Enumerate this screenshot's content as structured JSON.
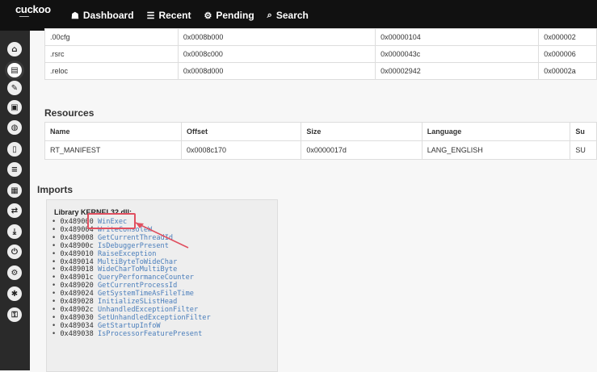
{
  "brand": {
    "logo": "cuckoo"
  },
  "nav": [
    {
      "icon": "dashboard-icon",
      "glyph": "☗",
      "label": "Dashboard"
    },
    {
      "icon": "list-icon",
      "glyph": "☰",
      "label": "Recent"
    },
    {
      "icon": "cogs-icon",
      "glyph": "⚙",
      "label": "Pending"
    },
    {
      "icon": "search-icon",
      "glyph": "⌕",
      "label": "Search"
    }
  ],
  "sidebar": [
    {
      "name": "home-icon",
      "glyph": "⌂"
    },
    {
      "name": "file-icon",
      "glyph": "▤"
    },
    {
      "name": "pencil-icon",
      "glyph": "✎"
    },
    {
      "name": "box-icon",
      "glyph": "▣"
    },
    {
      "name": "globe-icon",
      "glyph": "◍"
    },
    {
      "name": "document-icon",
      "glyph": "▯"
    },
    {
      "name": "database-icon",
      "glyph": "≡"
    },
    {
      "name": "qrcode-icon",
      "glyph": "▦"
    },
    {
      "name": "shuffle-icon",
      "glyph": "⇄"
    },
    {
      "name": "download-icon",
      "glyph": "⤓"
    },
    {
      "name": "power-icon",
      "glyph": "⏻"
    },
    {
      "name": "settings-icon",
      "glyph": "⚙"
    },
    {
      "name": "bug-icon",
      "glyph": "✱"
    },
    {
      "name": "unlock-icon",
      "glyph": "⚿"
    }
  ],
  "sections": {
    "rows": [
      [
        ".00cfg",
        "0x0008b000",
        "0x00000104",
        "0x000002"
      ],
      [
        ".rsrc",
        "0x0008c000",
        "0x0000043c",
        "0x000006"
      ],
      [
        ".reloc",
        "0x0008d000",
        "0x00002942",
        "0x00002a"
      ]
    ]
  },
  "resources": {
    "title": "Resources",
    "headers": [
      "Name",
      "Offset",
      "Size",
      "Language",
      "Su"
    ],
    "rows": [
      [
        "RT_MANIFEST",
        "0x0008c170",
        "0x0000017d",
        "LANG_ENGLISH",
        "SU"
      ]
    ]
  },
  "imports": {
    "title": "Imports",
    "library": "Library KERNEL32.dll:",
    "entries": [
      {
        "addr": "0x489000",
        "fn": "WinExec"
      },
      {
        "addr": "0x489004",
        "fn": "WriteConsoleW"
      },
      {
        "addr": "0x489008",
        "fn": "GetCurrentThreadId"
      },
      {
        "addr": "0x48900c",
        "fn": "IsDebuggerPresent"
      },
      {
        "addr": "0x489010",
        "fn": "RaiseException"
      },
      {
        "addr": "0x489014",
        "fn": "MultiByteToWideChar"
      },
      {
        "addr": "0x489018",
        "fn": "WideCharToMultiByte"
      },
      {
        "addr": "0x48901c",
        "fn": "QueryPerformanceCounter"
      },
      {
        "addr": "0x489020",
        "fn": "GetCurrentProcessId"
      },
      {
        "addr": "0x489024",
        "fn": "GetSystemTimeAsFileTime"
      },
      {
        "addr": "0x489028",
        "fn": "InitializeSListHead"
      },
      {
        "addr": "0x48902c",
        "fn": "UnhandledExceptionFilter"
      },
      {
        "addr": "0x489030",
        "fn": "SetUnhandledExceptionFilter"
      },
      {
        "addr": "0x489034",
        "fn": "GetStartupInfoW"
      },
      {
        "addr": "0x489038",
        "fn": "IsProcessorFeaturePresent"
      }
    ]
  },
  "colors": {
    "accent": "#e05060",
    "link": "#4a7ebb",
    "topbar": "#111111",
    "sidebar": "#2a2a2a"
  }
}
